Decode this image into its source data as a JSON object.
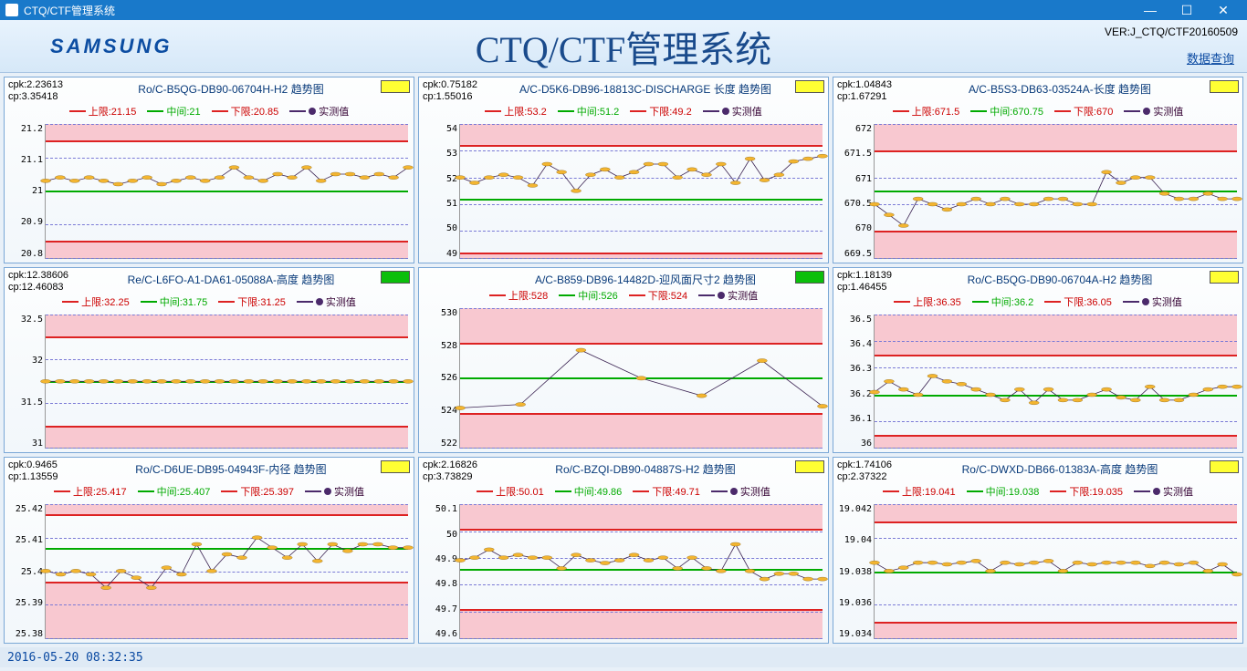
{
  "window": {
    "title": "CTQ/CTF管理系统"
  },
  "header": {
    "logo": "SAMSUNG",
    "title": "CTQ/CTF管理系统",
    "version": "VER:J_CTQ/CTF20160509",
    "query_link": "数据查询"
  },
  "legend_labels": {
    "upper_prefix": "上限:",
    "mid_prefix": "中间:",
    "lower_prefix": "下限:",
    "measured": "实测值"
  },
  "footer": {
    "timestamp": "2016-05-20 08:32:35"
  },
  "chart_data": [
    {
      "type": "line",
      "title": "Ro/C-B5QG-DB90-06704H-H2  趋势图",
      "cpk": "2.23613",
      "cp": "3.35418",
      "status": "yellow",
      "upper": 21.15,
      "mid": 21,
      "lower": 20.85,
      "yticks": [
        "21.2",
        "21.1",
        "21",
        "20.9",
        "20.8"
      ],
      "ylim": [
        20.8,
        21.2
      ],
      "values": [
        21.03,
        21.04,
        21.03,
        21.04,
        21.03,
        21.02,
        21.03,
        21.04,
        21.02,
        21.03,
        21.04,
        21.03,
        21.04,
        21.07,
        21.04,
        21.03,
        21.05,
        21.04,
        21.07,
        21.03,
        21.05,
        21.05,
        21.04,
        21.05,
        21.04,
        21.07
      ]
    },
    {
      "type": "line",
      "title": "A/C-D5K6-DB96-18813C-DISCHARGE 长度  趋势图",
      "cpk": "0.75182",
      "cp": "1.55016",
      "status": "yellow",
      "upper": 53.2,
      "mid": 51.2,
      "lower": 49.2,
      "yticks": [
        "54",
        "53",
        "52",
        "51",
        "50",
        "49"
      ],
      "ylim": [
        49,
        54
      ],
      "values": [
        52.0,
        51.8,
        52.0,
        52.1,
        52.0,
        51.7,
        52.5,
        52.2,
        51.5,
        52.1,
        52.3,
        52.0,
        52.2,
        52.5,
        52.5,
        52.0,
        52.3,
        52.1,
        52.5,
        51.8,
        52.7,
        51.9,
        52.1,
        52.6,
        52.7,
        52.8
      ]
    },
    {
      "type": "line",
      "title": "A/C-B5S3-DB63-03524A-长度  趋势图",
      "cpk": "1.04843",
      "cp": "1.67291",
      "status": "yellow",
      "upper": 671.5,
      "mid": 670.75,
      "lower": 670,
      "yticks": [
        "672",
        "671.5",
        "671",
        "670.5",
        "670",
        "669.5"
      ],
      "ylim": [
        669.5,
        672
      ],
      "values": [
        670.5,
        670.3,
        670.1,
        670.6,
        670.5,
        670.4,
        670.5,
        670.6,
        670.5,
        670.6,
        670.5,
        670.5,
        670.6,
        670.6,
        670.5,
        670.5,
        671.1,
        670.9,
        671.0,
        671.0,
        670.7,
        670.6,
        670.6,
        670.7,
        670.6,
        670.6
      ]
    },
    {
      "type": "line",
      "title": "Re/C-L6FO-A1-DA61-05088A-高度  趋势图",
      "cpk": "12.38606",
      "cp": "12.46083",
      "status": "green",
      "upper": 32.25,
      "mid": 31.75,
      "lower": 31.25,
      "yticks": [
        "32.5",
        "32",
        "31.5",
        "31"
      ],
      "ylim": [
        31,
        32.5
      ],
      "values": [
        31.75,
        31.75,
        31.75,
        31.75,
        31.75,
        31.75,
        31.75,
        31.75,
        31.75,
        31.75,
        31.75,
        31.75,
        31.75,
        31.75,
        31.75,
        31.75,
        31.75,
        31.75,
        31.75,
        31.75,
        31.75,
        31.75,
        31.75,
        31.75,
        31.75,
        31.75
      ]
    },
    {
      "type": "line",
      "title": "A/C-B859-DB96-14482D-迎风面尺寸2  趋势图",
      "cpk": "",
      "cp": "",
      "status": "green",
      "upper": 528,
      "mid": 526,
      "lower": 524,
      "yticks": [
        "530",
        "528",
        "526",
        "524",
        "522"
      ],
      "ylim": [
        522,
        530
      ],
      "values": [
        524.3,
        524.5,
        527.6,
        526.0,
        525.0,
        527.0,
        524.4
      ]
    },
    {
      "type": "line",
      "title": "Ro/C-B5QG-DB90-06704A-H2  趋势图",
      "cpk": "1.18139",
      "cp": "1.46455",
      "status": "yellow",
      "upper": 36.35,
      "mid": 36.2,
      "lower": 36.05,
      "yticks": [
        "36.5",
        "36.4",
        "36.3",
        "36.2",
        "36.1",
        "36"
      ],
      "ylim": [
        36,
        36.5
      ],
      "values": [
        36.21,
        36.25,
        36.22,
        36.2,
        36.27,
        36.25,
        36.24,
        36.22,
        36.2,
        36.18,
        36.22,
        36.17,
        36.22,
        36.18,
        36.18,
        36.2,
        36.22,
        36.19,
        36.18,
        36.23,
        36.18,
        36.18,
        36.2,
        36.22,
        36.23,
        36.23
      ]
    },
    {
      "type": "line",
      "title": "Ro/C-D6UE-DB95-04943F-内径  趋势图",
      "cpk": "0.9465",
      "cp": "1.13559",
      "status": "yellow",
      "upper": 25.417,
      "mid": 25.407,
      "lower": 25.397,
      "yticks": [
        "25.42",
        "25.41",
        "25.4",
        "25.39",
        "25.38"
      ],
      "ylim": [
        25.38,
        25.42
      ],
      "values": [
        25.4,
        25.399,
        25.4,
        25.399,
        25.395,
        25.4,
        25.398,
        25.395,
        25.401,
        25.399,
        25.408,
        25.4,
        25.405,
        25.404,
        25.41,
        25.407,
        25.404,
        25.408,
        25.403,
        25.408,
        25.406,
        25.408,
        25.408,
        25.407,
        25.407
      ]
    },
    {
      "type": "line",
      "title": "Ro/C-BZQI-DB90-04887S-H2  趋势图",
      "cpk": "2.16826",
      "cp": "3.73829",
      "status": "yellow",
      "upper": 50.01,
      "mid": 49.86,
      "lower": 49.71,
      "yticks": [
        "50.1",
        "50",
        "49.9",
        "49.8",
        "49.7",
        "49.6"
      ],
      "ylim": [
        49.6,
        50.1
      ],
      "values": [
        49.89,
        49.9,
        49.93,
        49.9,
        49.91,
        49.9,
        49.9,
        49.86,
        49.91,
        49.89,
        49.88,
        49.89,
        49.91,
        49.89,
        49.9,
        49.86,
        49.9,
        49.86,
        49.85,
        49.95,
        49.85,
        49.82,
        49.84,
        49.84,
        49.82,
        49.82
      ]
    },
    {
      "type": "line",
      "title": "Ro/C-DWXD-DB66-01383A-高度  趋势图",
      "cpk": "1.74106",
      "cp": "2.37322",
      "status": "yellow",
      "upper": 19.041,
      "mid": 19.038,
      "lower": 19.035,
      "yticks": [
        "19.042",
        "19.04",
        "19.038",
        "19.036",
        "19.034"
      ],
      "ylim": [
        19.034,
        19.042
      ],
      "values": [
        19.0385,
        19.038,
        19.0382,
        19.0385,
        19.0385,
        19.0384,
        19.0385,
        19.0386,
        19.038,
        19.0385,
        19.0384,
        19.0385,
        19.0386,
        19.038,
        19.0385,
        19.0384,
        19.0385,
        19.0385,
        19.0385,
        19.0383,
        19.0385,
        19.0384,
        19.0385,
        19.038,
        19.0384,
        19.0378
      ]
    }
  ]
}
